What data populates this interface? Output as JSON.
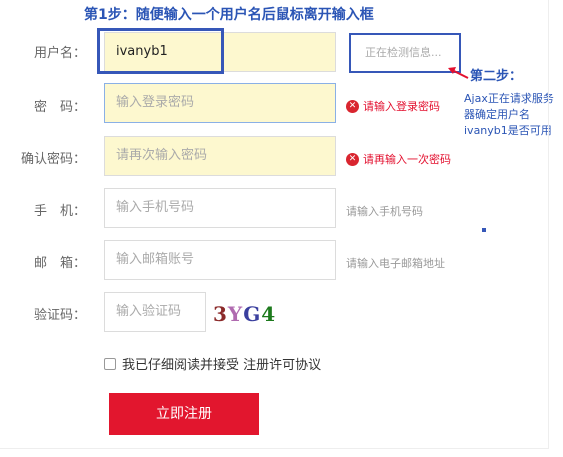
{
  "annotations": {
    "step1": "第1步：随便输入一个用户名后鼠标离开输入框",
    "step2": "第二步：",
    "step2_note": "Ajax正在请求服务器确定用户名ivanyb1是否可用"
  },
  "form": {
    "username": {
      "label": "用户名：",
      "value": "ivanyb1",
      "status": "正在检测信息..."
    },
    "password": {
      "label": "密　码：",
      "placeholder": "输入登录密码",
      "error": "请输入登录密码"
    },
    "confirm": {
      "label": "确认密码：",
      "placeholder": "请再次输入密码",
      "error": "请再输入一次密码"
    },
    "phone": {
      "label": "手　机：",
      "placeholder": "输入手机号码",
      "hint": "请输入手机号码"
    },
    "email": {
      "label": "邮　箱：",
      "placeholder": "输入邮箱账号",
      "hint": "请输入电子邮箱地址"
    },
    "captcha": {
      "label": "验证码：",
      "placeholder": "输入验证码",
      "code_chars": [
        "3",
        "Y",
        "G",
        "4"
      ]
    },
    "agree_text": "我已仔细阅读并接受 注册许可协议",
    "submit_label": "立即注册"
  },
  "colors": {
    "annotation_blue": "#2b55b5",
    "error_red": "#e3102f",
    "submit_red": "#e2162e",
    "autofill_yellow": "#fdf8cf",
    "captcha_char_colors": [
      "#8b2a2a",
      "#b06bb0",
      "#3a3f9e",
      "#1d7a1d"
    ]
  },
  "icons": {
    "error": "error-x-icon",
    "arrow": "red-arrow-icon"
  }
}
